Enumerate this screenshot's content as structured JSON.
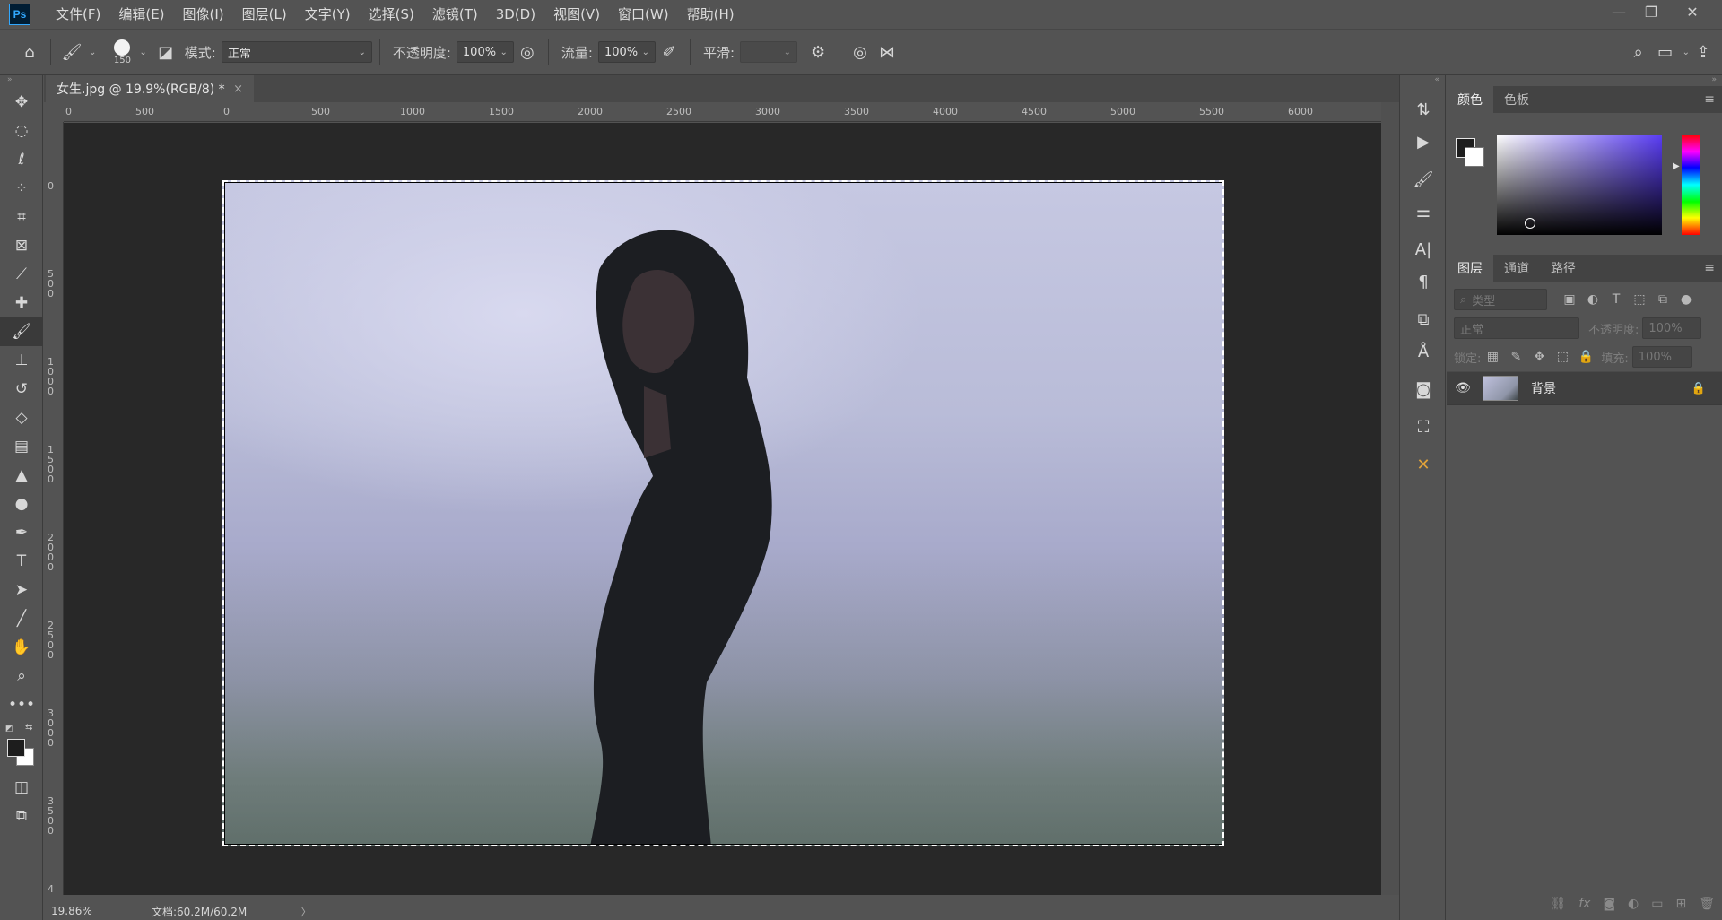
{
  "app": {
    "logo": "Ps"
  },
  "menu": [
    "文件(F)",
    "编辑(E)",
    "图像(I)",
    "图层(L)",
    "文字(Y)",
    "选择(S)",
    "滤镜(T)",
    "3D(D)",
    "视图(V)",
    "窗口(W)",
    "帮助(H)"
  ],
  "window_controls": {
    "minimize": "—",
    "restore": "❐",
    "close": "✕"
  },
  "options": {
    "brush_size": "150",
    "mode_label": "模式:",
    "mode_value": "正常",
    "opacity_label": "不透明度:",
    "opacity_value": "100%",
    "flow_label": "流量:",
    "flow_value": "100%",
    "smoothing_label": "平滑:",
    "smoothing_value": ""
  },
  "document": {
    "tab_title": "女生.jpg @ 19.9%(RGB/8) *",
    "tab_close": "×",
    "ruler_top": [
      "0",
      "500",
      "0",
      "500",
      "1000",
      "1500",
      "2000",
      "2500",
      "3000",
      "3500",
      "4000",
      "4500",
      "5000",
      "5500",
      "6000"
    ],
    "ruler_left": [
      "0",
      "5\n0\n0",
      "1\n0\n0\n0",
      "1\n5\n0\n0",
      "2\n0\n0\n0",
      "2\n5\n0\n0",
      "3\n0\n0\n0",
      "3\n5\n0\n0",
      "4"
    ]
  },
  "status": {
    "zoom": "19.86%",
    "doc_info": "文档:60.2M/60.2M",
    "arrow": "〉"
  },
  "color_panel": {
    "tabs": [
      "颜色",
      "色板"
    ],
    "active_tab": "颜色",
    "fg_color": "#1d1d1d",
    "bg_color": "#ffffff"
  },
  "layers_panel": {
    "tabs": [
      "图层",
      "通道",
      "路径"
    ],
    "active_tab": "图层",
    "filter_placeholder": "类型",
    "blend_mode": "正常",
    "opacity_label": "不透明度:",
    "opacity_value": "100%",
    "lock_label": "锁定:",
    "fill_label": "填充:",
    "fill_value": "100%",
    "layers": [
      {
        "name": "背景",
        "visible": true,
        "locked": true
      }
    ]
  }
}
